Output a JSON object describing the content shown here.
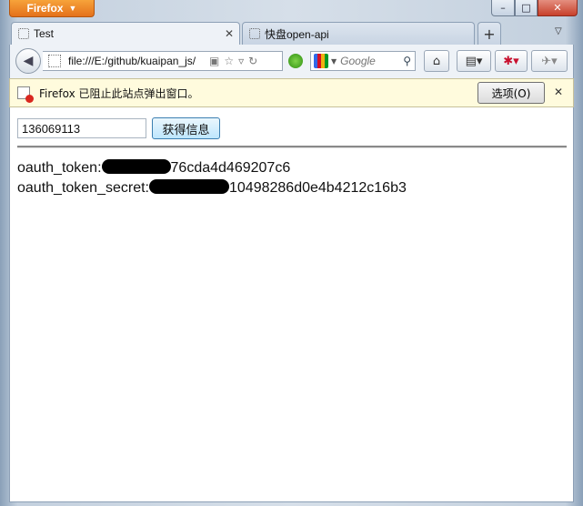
{
  "browser": {
    "app_button": "Firefox",
    "window_controls": {
      "minimize": "–",
      "maximize": "□",
      "close": "✕"
    }
  },
  "tabs": [
    {
      "label": "Test",
      "active": true
    },
    {
      "label": "快盘open-api",
      "active": false
    }
  ],
  "navbar": {
    "url": "file:///E:/github/kuaipan_js/",
    "search_placeholder": "Google",
    "icons": [
      "back-icon",
      "site-identity-icon",
      "page-icon",
      "bookmark-star-icon",
      "reload-icon",
      "addon-green-icon",
      "google-icon",
      "magnifier-icon",
      "home-icon",
      "bookmarks-menu-icon",
      "addon-red-icon",
      "addon-gray-icon"
    ]
  },
  "notification": {
    "message": "Firefox 已阻止此站点弹出窗口。",
    "options_label": "选项(O)",
    "close": "✕"
  },
  "page": {
    "input_value": "136069113",
    "button_label": "获得信息",
    "token_label": "oauth_token:",
    "token_visible_suffix": "76cda4d469207c6",
    "secret_label": "oauth_token_secret:",
    "secret_visible_suffix": "10498286d0e4b4212c16b3"
  }
}
